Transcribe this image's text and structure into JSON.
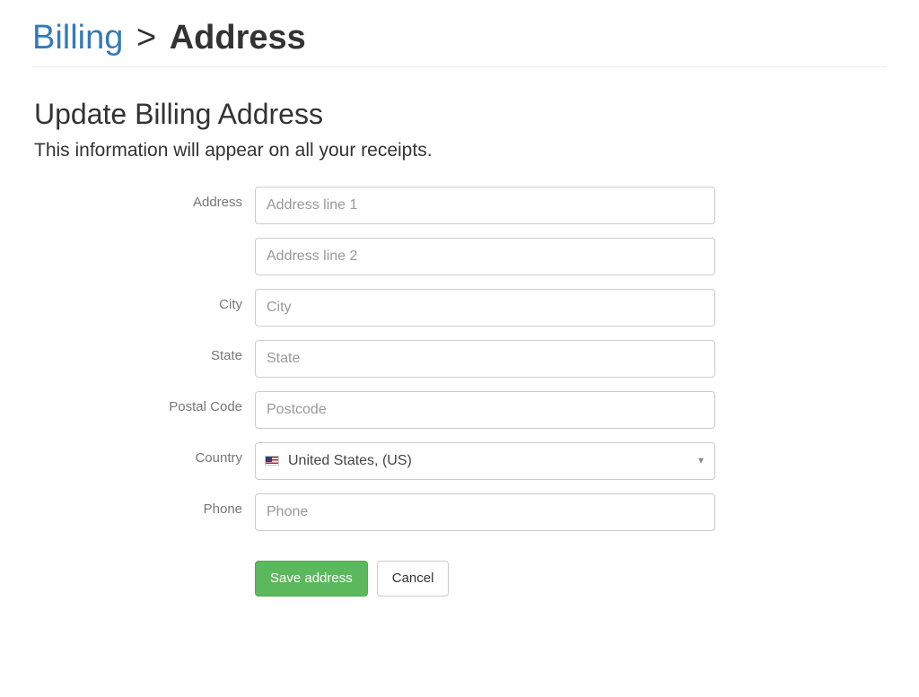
{
  "breadcrumb": {
    "link": "Billing",
    "separator": ">",
    "current": "Address"
  },
  "heading": "Update Billing Address",
  "lead": "This information will appear on all your receipts.",
  "labels": {
    "address": "Address",
    "city": "City",
    "state": "State",
    "postal": "Postal Code",
    "country": "Country",
    "phone": "Phone"
  },
  "placeholders": {
    "address1": "Address line 1",
    "address2": "Address line 2",
    "city": "City",
    "state": "State",
    "postal": "Postcode",
    "phone": "Phone"
  },
  "values": {
    "address1": "",
    "address2": "",
    "city": "",
    "state": "",
    "postal": "",
    "phone": ""
  },
  "country": {
    "selected": "United States, (US)"
  },
  "buttons": {
    "save": "Save address",
    "cancel": "Cancel"
  }
}
